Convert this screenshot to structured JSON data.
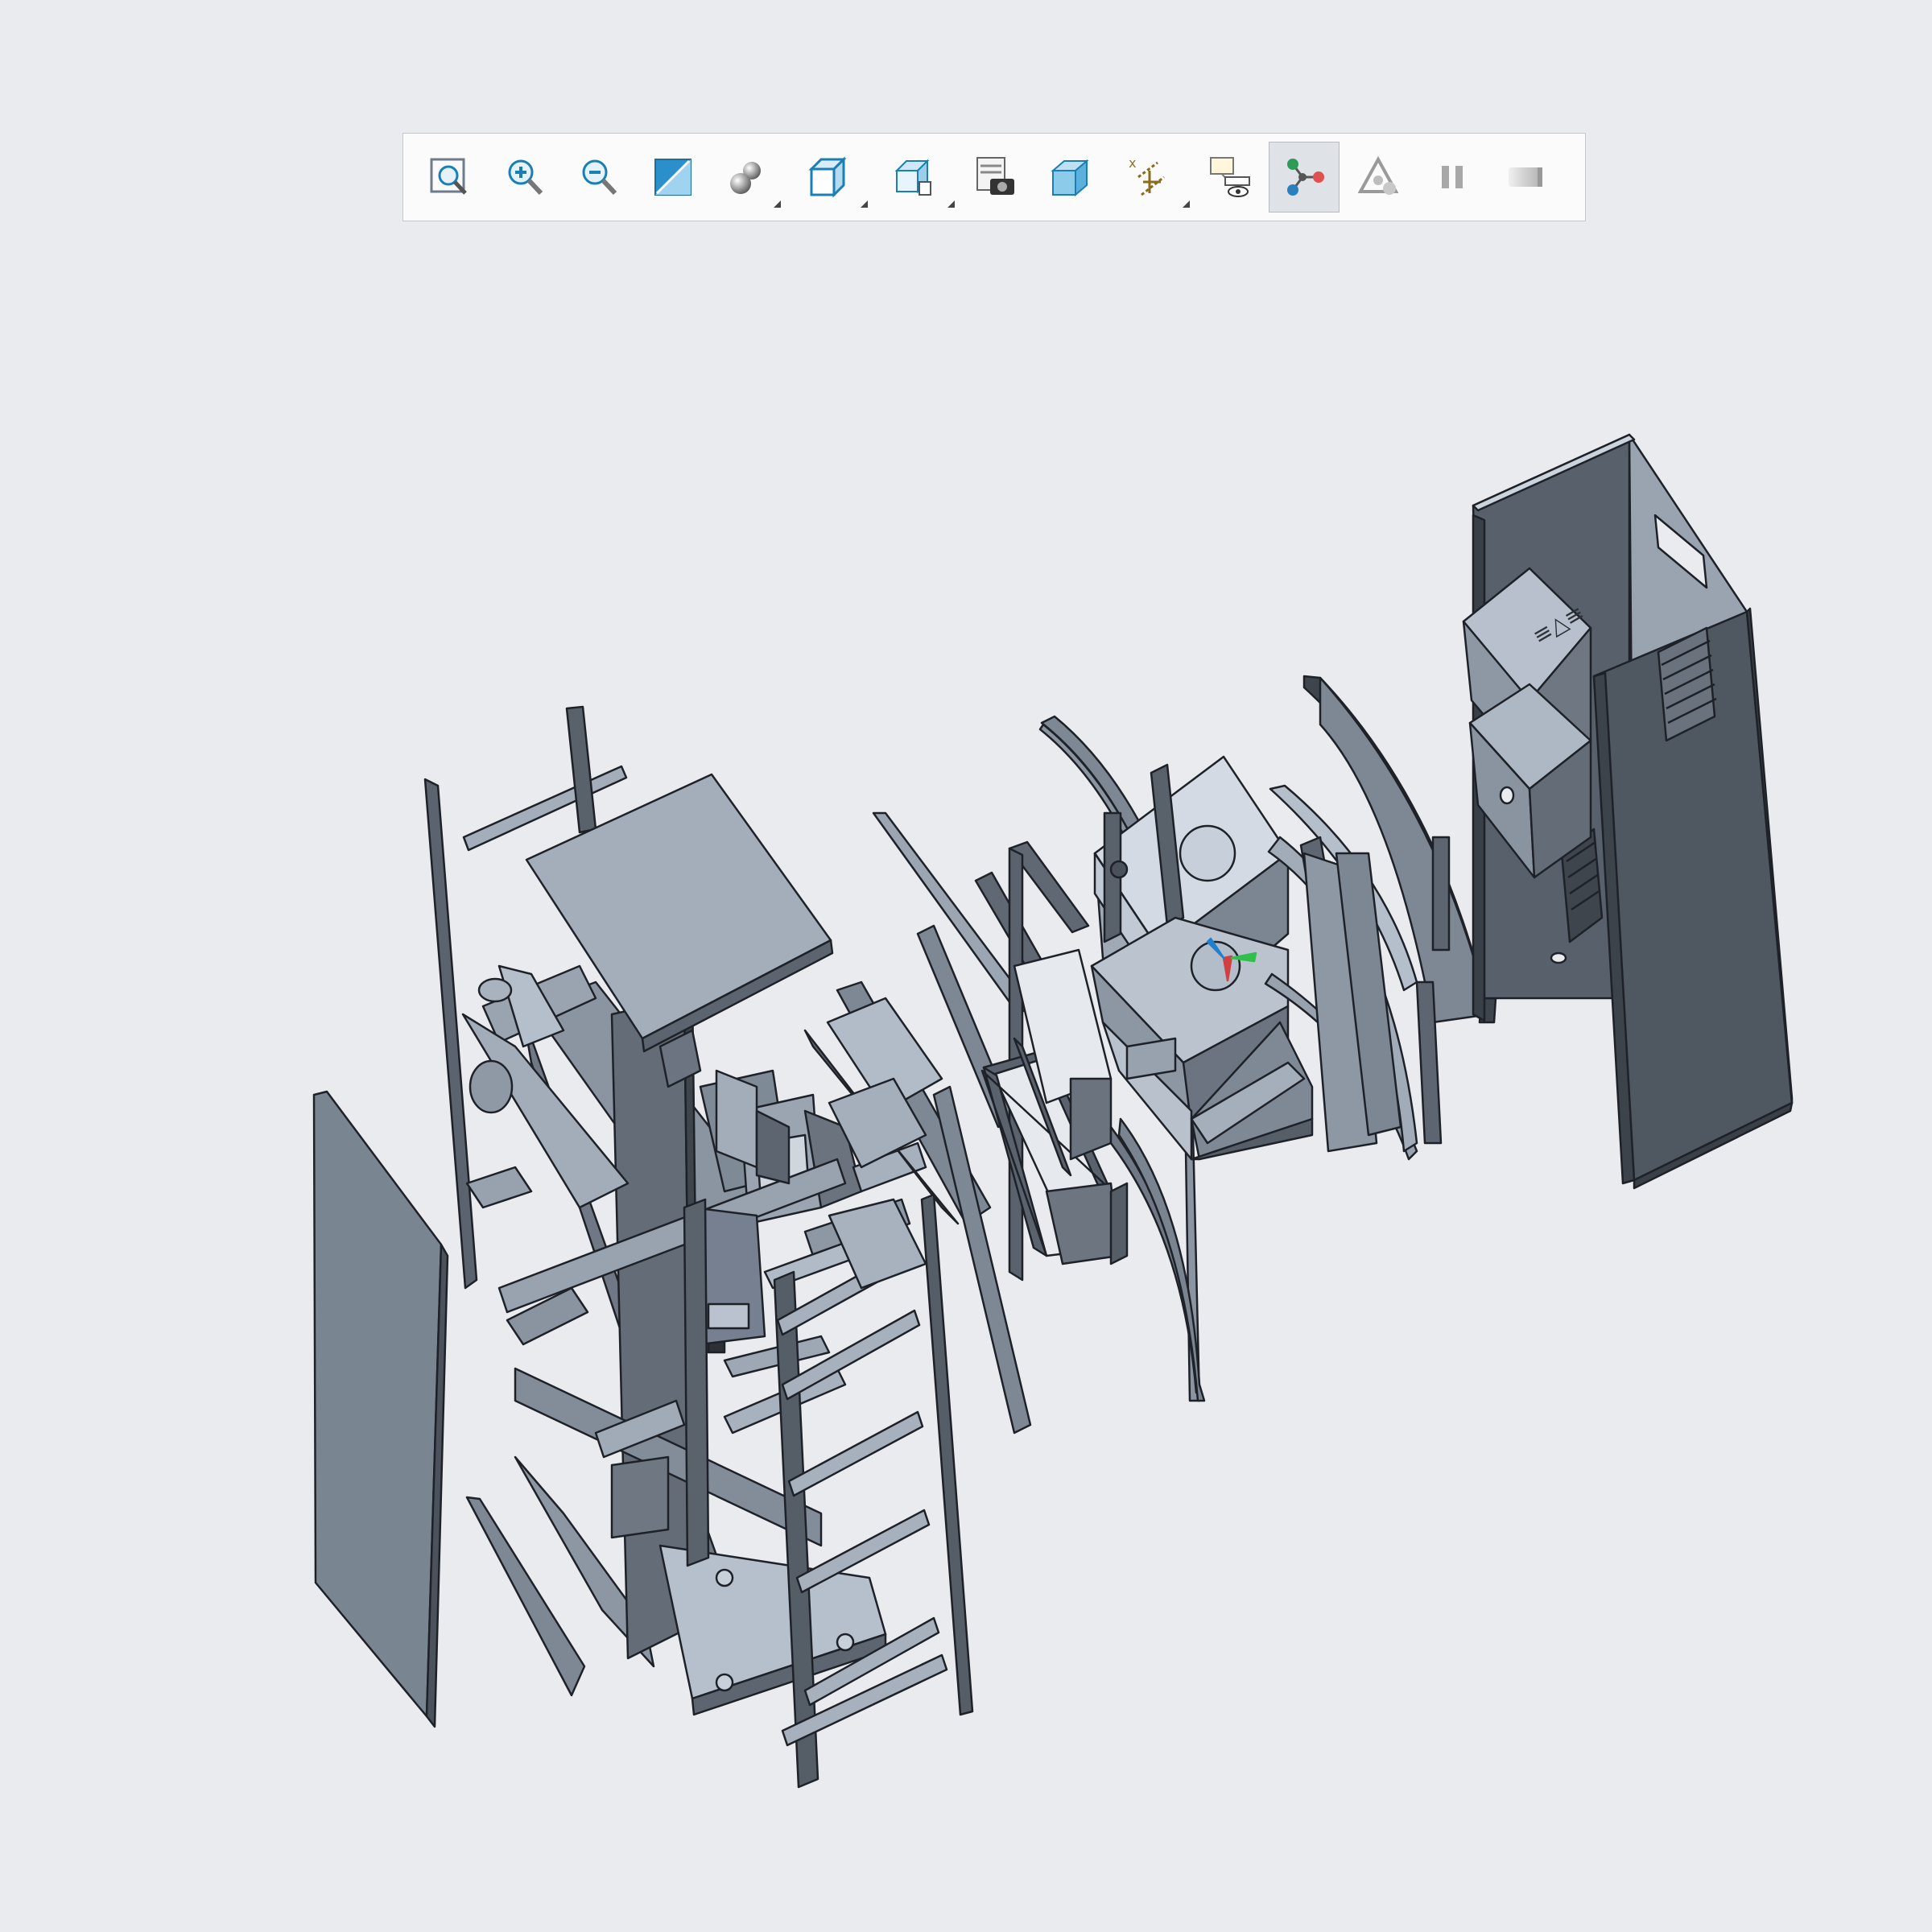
{
  "window": {
    "background": "#e9ebee"
  },
  "toolbar": {
    "buttons": [
      {
        "name": "refit",
        "icon": "zoom-fit-icon",
        "state": "normal"
      },
      {
        "name": "zoom-in",
        "icon": "zoom-in-icon",
        "state": "normal"
      },
      {
        "name": "zoom-out",
        "icon": "zoom-out-icon",
        "state": "normal"
      },
      {
        "name": "repaint",
        "icon": "repaint-icon",
        "state": "normal"
      },
      {
        "name": "perspective",
        "icon": "shading-sphere-icon",
        "state": "normal",
        "flyout": true
      },
      {
        "name": "display-style",
        "icon": "display-style-cube-icon",
        "state": "normal",
        "flyout": true
      },
      {
        "name": "saved-orientations",
        "icon": "saved-orientations-icon",
        "state": "normal",
        "flyout": true
      },
      {
        "name": "view-manager",
        "icon": "view-manager-camera-icon",
        "state": "normal"
      },
      {
        "name": "section",
        "icon": "section-cube-icon",
        "state": "normal"
      },
      {
        "name": "datum-display",
        "icon": "datum-display-icon",
        "state": "normal",
        "flyout": true
      },
      {
        "name": "annotation-display",
        "icon": "annotation-display-icon",
        "state": "normal"
      },
      {
        "name": "explode-view",
        "icon": "explode-view-icon",
        "state": "active"
      },
      {
        "name": "spin-center",
        "icon": "spin-center-icon",
        "state": "disabled"
      },
      {
        "name": "pause",
        "icon": "pause-icon",
        "state": "disabled"
      },
      {
        "name": "end-animation",
        "icon": "end-animation-icon",
        "state": "disabled"
      }
    ],
    "accent": "#1a7fb5",
    "active_background": "#dfe2e6"
  },
  "model": {
    "description_color_dark": "#575e68",
    "description_color_light": "#a6b0bd",
    "edge_color": "#1e2228"
  }
}
